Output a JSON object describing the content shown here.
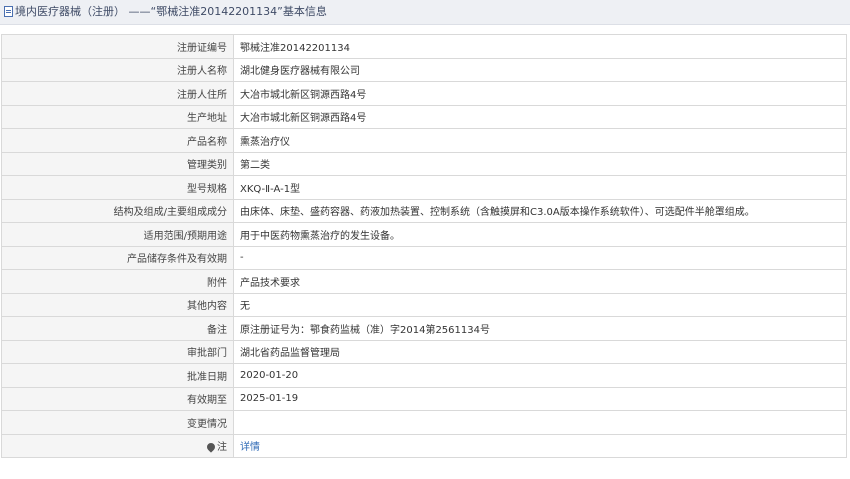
{
  "header": {
    "title": "境内医疗器械（注册） ——“鄂械注准20142201134”基本信息"
  },
  "rows": [
    {
      "label": "注册证编号",
      "value": "鄂械注准20142201134"
    },
    {
      "label": "注册人名称",
      "value": "湖北健身医疗器械有限公司"
    },
    {
      "label": "注册人住所",
      "value": "大冶市城北新区铜源西路4号"
    },
    {
      "label": "生产地址",
      "value": "大冶市城北新区铜源西路4号"
    },
    {
      "label": "产品名称",
      "value": "熏蒸治疗仪"
    },
    {
      "label": "管理类别",
      "value": "第二类"
    },
    {
      "label": "型号规格",
      "value": "XKQ-Ⅱ-A-1型"
    },
    {
      "label": "结构及组成/主要组成成分",
      "value": "由床体、床垫、盛药容器、药液加热装置、控制系统（含触摸屏和C3.0A版本操作系统软件）、可选配件半舱罩组成。"
    },
    {
      "label": "适用范围/预期用途",
      "value": "用于中医药物熏蒸治疗的发生设备。"
    },
    {
      "label": "产品储存条件及有效期",
      "value": "-"
    },
    {
      "label": "附件",
      "value": "产品技术要求"
    },
    {
      "label": "其他内容",
      "value": "无"
    },
    {
      "label": "备注",
      "value": "原注册证号为：鄂食药监械（准）字2014第2561134号"
    },
    {
      "label": "审批部门",
      "value": "湖北省药品监督管理局"
    },
    {
      "label": "批准日期",
      "value": "2020-01-20"
    },
    {
      "label": "有效期至",
      "value": "2025-01-19"
    },
    {
      "label": "变更情况",
      "value": ""
    },
    {
      "label": "注",
      "value": "详情",
      "icon": "note-icon"
    }
  ]
}
